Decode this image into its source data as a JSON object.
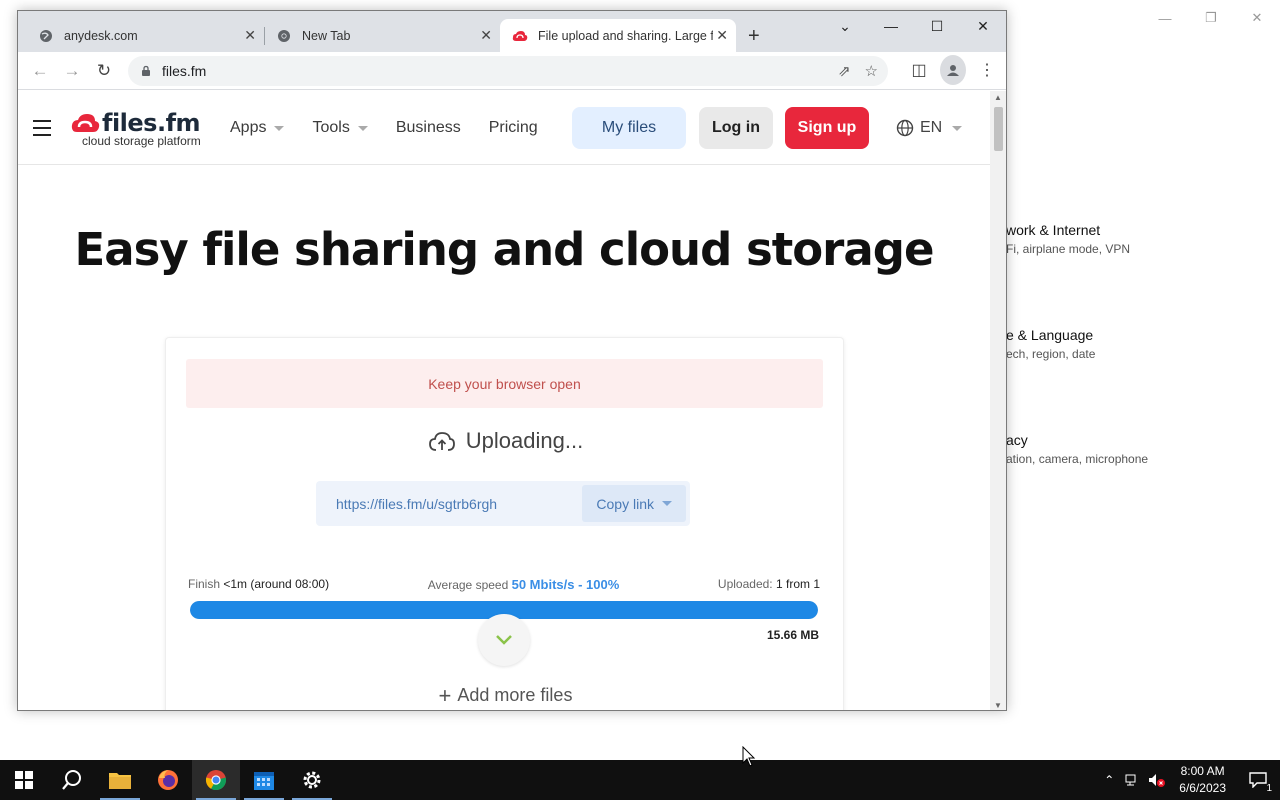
{
  "background_window": {
    "categories": [
      {
        "title": "work & Internet",
        "subtitle": "Fi, airplane mode, VPN"
      },
      {
        "title": "e & Language",
        "subtitle": "ech, region, date"
      },
      {
        "title": "acy",
        "subtitle": "ation, camera, microphone"
      }
    ]
  },
  "browser": {
    "tabs": [
      {
        "title": "anydesk.com",
        "icon": "globe-icon"
      },
      {
        "title": "New Tab",
        "icon": "chrome-icon"
      },
      {
        "title": "File upload and sharing. Large fil",
        "icon": "filesfm-icon"
      }
    ],
    "address": "files.fm"
  },
  "site": {
    "logo_main": "files.fm",
    "logo_sub": "cloud storage platform",
    "nav": [
      {
        "label": "Apps",
        "dropdown": true
      },
      {
        "label": "Tools",
        "dropdown": true
      },
      {
        "label": "Business",
        "dropdown": false
      },
      {
        "label": "Pricing",
        "dropdown": false
      }
    ],
    "my_files": "My files",
    "login": "Log in",
    "signup": "Sign up",
    "language": "EN",
    "hero": "Easy file sharing and cloud storage"
  },
  "upload": {
    "alert": "Keep your browser open",
    "status": "Uploading...",
    "link": "https://files.fm/u/sgtrb6rgh",
    "copy_label": "Copy link",
    "finish_label": "Finish",
    "finish_value": "<1m (around 08:00)",
    "speed_label": "Average speed",
    "speed_value": "50 Mbits/s - 100%",
    "uploaded_label": "Uploaded:",
    "uploaded_value": "1 from 1",
    "progress": 1.0,
    "size": "15.66 MB",
    "add_more": "Add more files"
  },
  "taskbar": {
    "time": "8:00 AM",
    "date": "6/6/2023",
    "notification_count": "1"
  },
  "colors": {
    "brand_red": "#e8273c",
    "progress_blue": "#1e88e5",
    "link_blue": "#4a7ab5"
  }
}
